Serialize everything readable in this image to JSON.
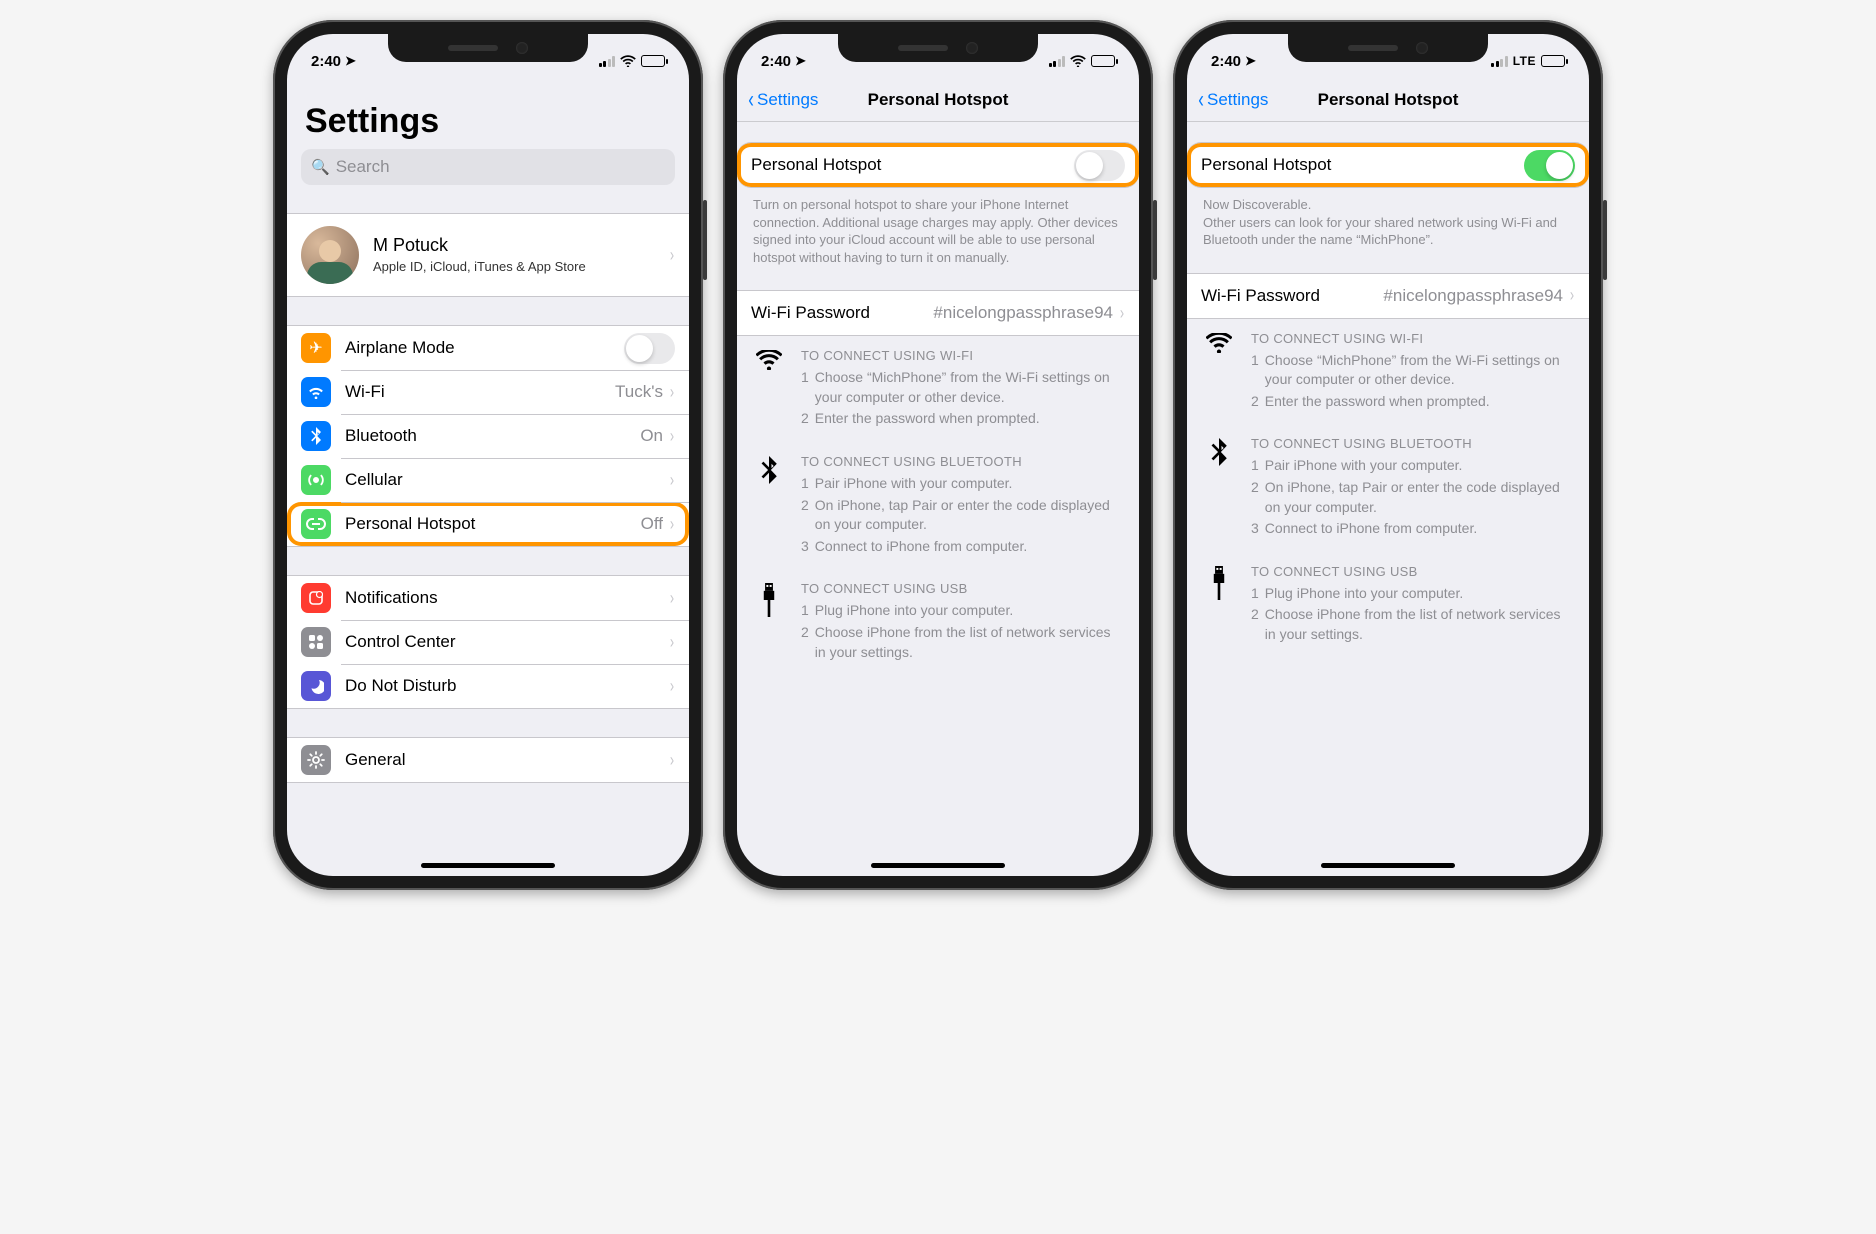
{
  "status": {
    "time": "2:40",
    "lte": "LTE"
  },
  "settings": {
    "title": "Settings",
    "search_placeholder": "Search",
    "profile": {
      "name": "M Potuck",
      "subtitle": "Apple ID, iCloud, iTunes & App Store"
    },
    "items": {
      "airplane": "Airplane Mode",
      "wifi": "Wi-Fi",
      "wifi_value": "Tuck's",
      "bluetooth": "Bluetooth",
      "bluetooth_value": "On",
      "cellular": "Cellular",
      "hotspot": "Personal Hotspot",
      "hotspot_value": "Off",
      "notifications": "Notifications",
      "control_center": "Control Center",
      "dnd": "Do Not Disturb",
      "general": "General"
    }
  },
  "hotspot": {
    "back": "Settings",
    "title": "Personal Hotspot",
    "toggle_label": "Personal Hotspot",
    "off_footer": "Turn on personal hotspot to share your iPhone Internet connection. Additional usage charges may apply. Other devices signed into your iCloud account will be able to use personal hotspot without having to turn it on manually.",
    "on_footer_line1": "Now Discoverable.",
    "on_footer_line2": "Other users can look for your shared network using Wi-Fi and Bluetooth under the name “MichPhone”.",
    "password_label": "Wi-Fi Password",
    "password_value": "#nicelongpassphrase94",
    "wifi_head": "TO CONNECT USING WI-FI",
    "wifi_s1": "Choose “MichPhone” from the Wi-Fi settings on your computer or other device.",
    "wifi_s2": "Enter the password when prompted.",
    "bt_head": "TO CONNECT USING BLUETOOTH",
    "bt_s1": "Pair iPhone with your computer.",
    "bt_s2": "On iPhone, tap Pair or enter the code displayed on your computer.",
    "bt_s3": "Connect to iPhone from computer.",
    "usb_head": "TO CONNECT USING USB",
    "usb_s1": "Plug iPhone into your computer.",
    "usb_s2": "Choose iPhone from the list of network services in your settings."
  }
}
